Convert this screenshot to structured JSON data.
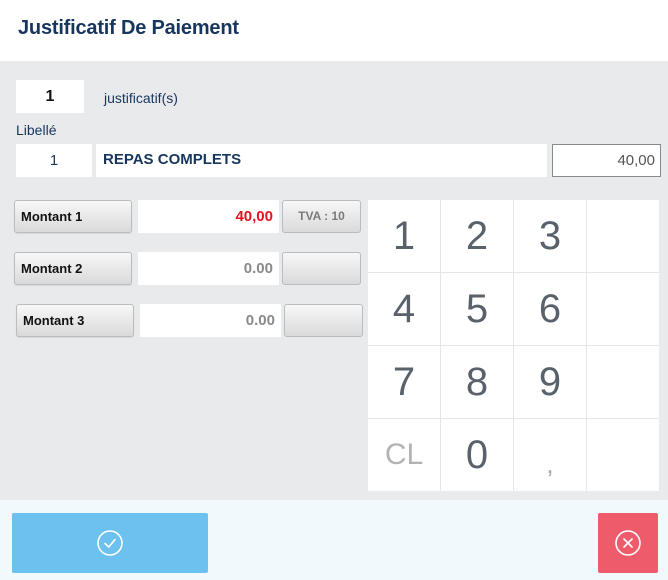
{
  "header": {
    "title": "Justificatif De Paiement"
  },
  "count": {
    "value": "1",
    "label": "justificatif(s)"
  },
  "libelle": {
    "label": "Libellé",
    "line": {
      "number": "1",
      "description": "REPAS COMPLETS",
      "amount": "40,00"
    }
  },
  "montants": [
    {
      "label": "Montant 1",
      "value": "40,00",
      "tva": "TVA : 10",
      "value_color": "#e0141e"
    },
    {
      "label": "Montant 2",
      "value": "0.00",
      "tva": "",
      "value_color": "#8a8a8a"
    },
    {
      "label": "Montant 3",
      "value": "0.00",
      "tva": "",
      "value_color": "#8a8a8a"
    }
  ],
  "keypad": {
    "keys": [
      "1",
      "2",
      "3",
      "",
      "4",
      "5",
      "6",
      "",
      "7",
      "8",
      "9",
      "",
      "CL",
      "0",
      ",",
      ""
    ]
  },
  "actions": {
    "confirm_icon": "check-circle-icon",
    "cancel_icon": "close-circle-icon"
  },
  "colors": {
    "title": "#17365d",
    "confirm": "#6cc1ee",
    "cancel": "#ee5b6b",
    "highlight": "#e0141e"
  }
}
